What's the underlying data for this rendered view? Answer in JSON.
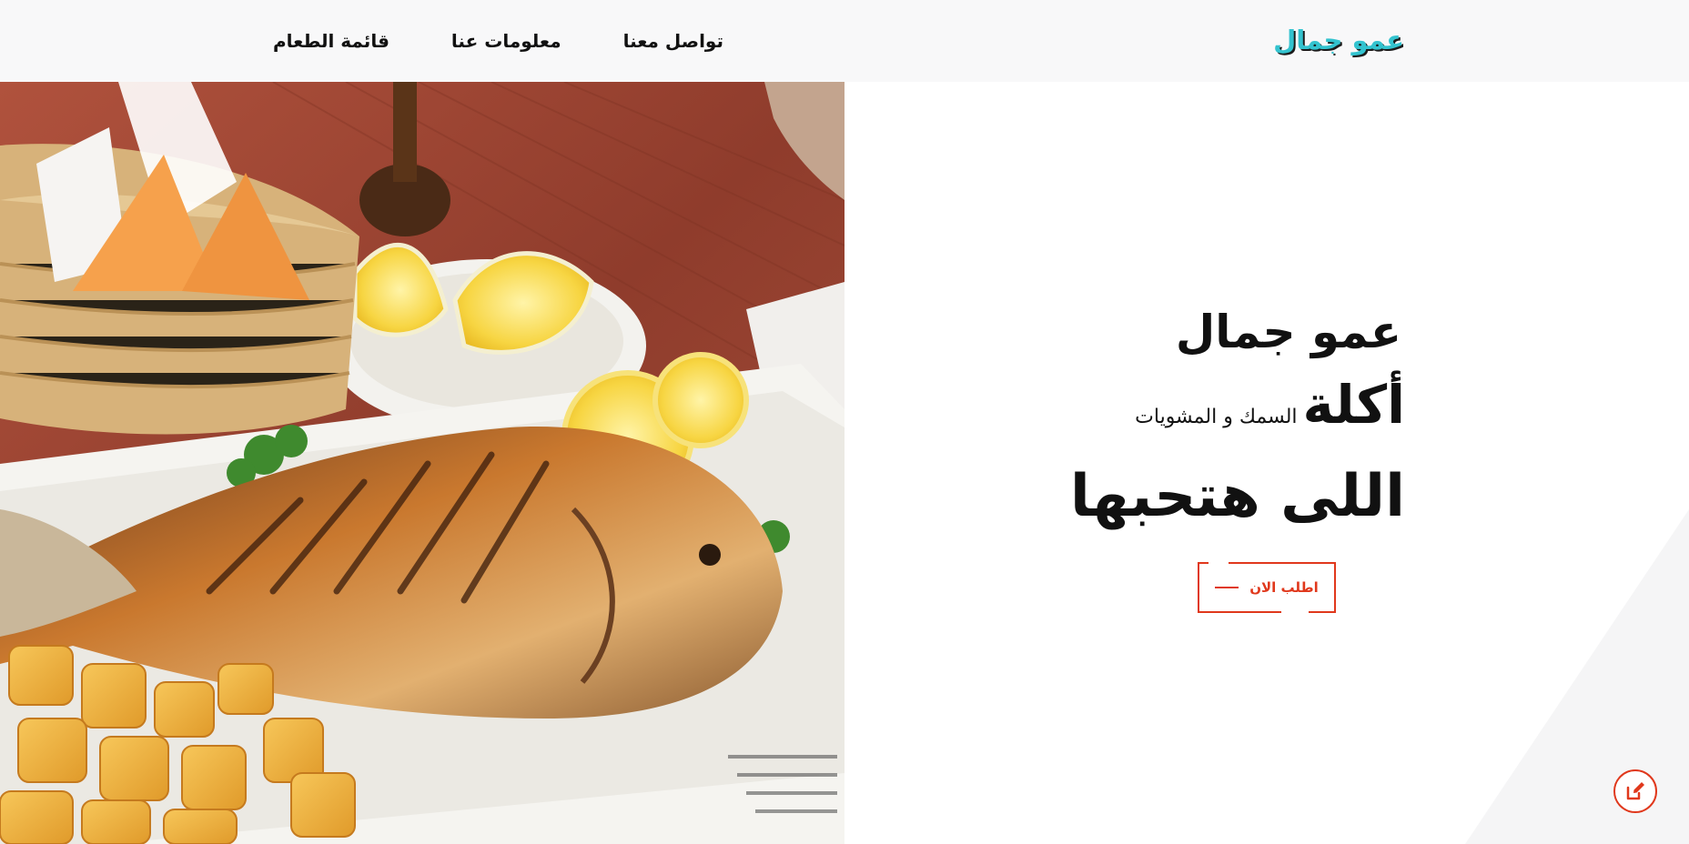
{
  "navbar": {
    "brand": "عمو جمال",
    "links": [
      {
        "label": "قائمة الطعام"
      },
      {
        "label": "معلومات عنا"
      },
      {
        "label": "تواصل معنا"
      }
    ]
  },
  "hero": {
    "title": "عمو جمال",
    "line2_big": "أكلة",
    "line2_small": "السمك و المشويات",
    "line3": "اللى هتحبها",
    "cta_label": "اطلب الان",
    "image_icon": "grilled-fish-photo"
  },
  "fab": {
    "icon": "edit-icon"
  },
  "colors": {
    "accent": "#e0381c",
    "brand": "#33c3cf",
    "navbar_bg": "#f8f8f9",
    "text": "#111111"
  }
}
